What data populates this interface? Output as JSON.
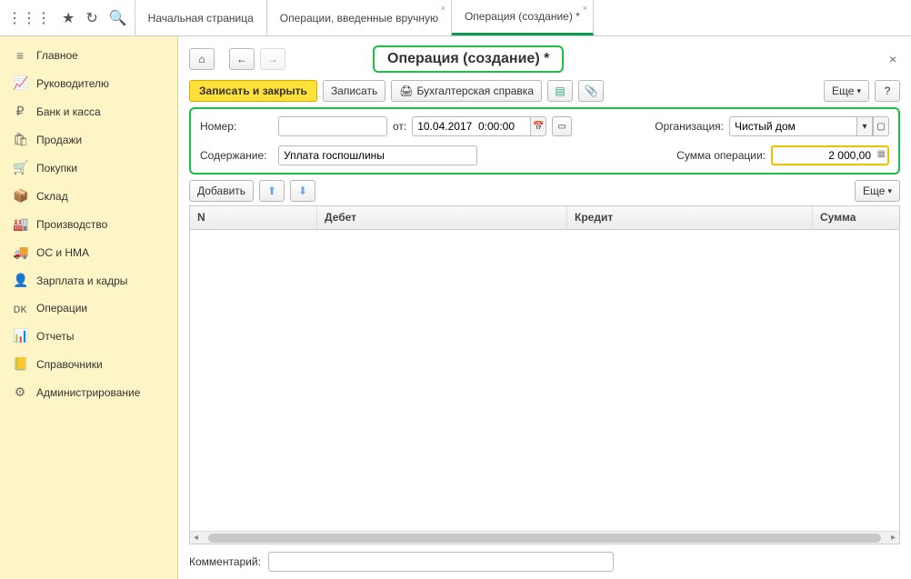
{
  "tabs": [
    {
      "label": "Начальная страница"
    },
    {
      "label": "Операции, введенные вручную"
    },
    {
      "label": "Операция (создание) *"
    }
  ],
  "sidebar": {
    "items": [
      {
        "icon": "≡",
        "label": "Главное"
      },
      {
        "icon": "📈",
        "label": "Руководителю"
      },
      {
        "icon": "₽",
        "label": "Банк и касса"
      },
      {
        "icon": "🛍",
        "label": "Продажи"
      },
      {
        "icon": "🛒",
        "label": "Покупки"
      },
      {
        "icon": "📦",
        "label": "Склад"
      },
      {
        "icon": "🏭",
        "label": "Производство"
      },
      {
        "icon": "🚚",
        "label": "ОС и НМА"
      },
      {
        "icon": "👤",
        "label": "Зарплата и кадры"
      },
      {
        "icon": "ᴅᴋ",
        "label": "Операции"
      },
      {
        "icon": "📊",
        "label": "Отчеты"
      },
      {
        "icon": "📒",
        "label": "Справочники"
      },
      {
        "icon": "⚙",
        "label": "Администрирование"
      }
    ]
  },
  "page": {
    "title": "Операция (создание) *",
    "actions": {
      "save_close": "Записать и закрыть",
      "save": "Записать",
      "print_ref": "Бухгалтерская справка",
      "more": "Еще",
      "help": "?"
    },
    "form": {
      "number_label": "Номер:",
      "number_value": "",
      "date_label": "от:",
      "date_value": "10.04.2017  0:00:00",
      "org_label": "Организация:",
      "org_value": "Чистый дом",
      "content_label": "Содержание:",
      "content_value": "Уплата госпошлины",
      "sum_label": "Сумма операции:",
      "sum_value": "2 000,00"
    },
    "table_toolbar": {
      "add": "Добавить",
      "more": "Еще"
    },
    "table": {
      "cols": {
        "n": "N",
        "debit": "Дебет",
        "credit": "Кредит",
        "sum": "Сумма"
      }
    },
    "comment_label": "Комментарий:",
    "comment_value": ""
  }
}
